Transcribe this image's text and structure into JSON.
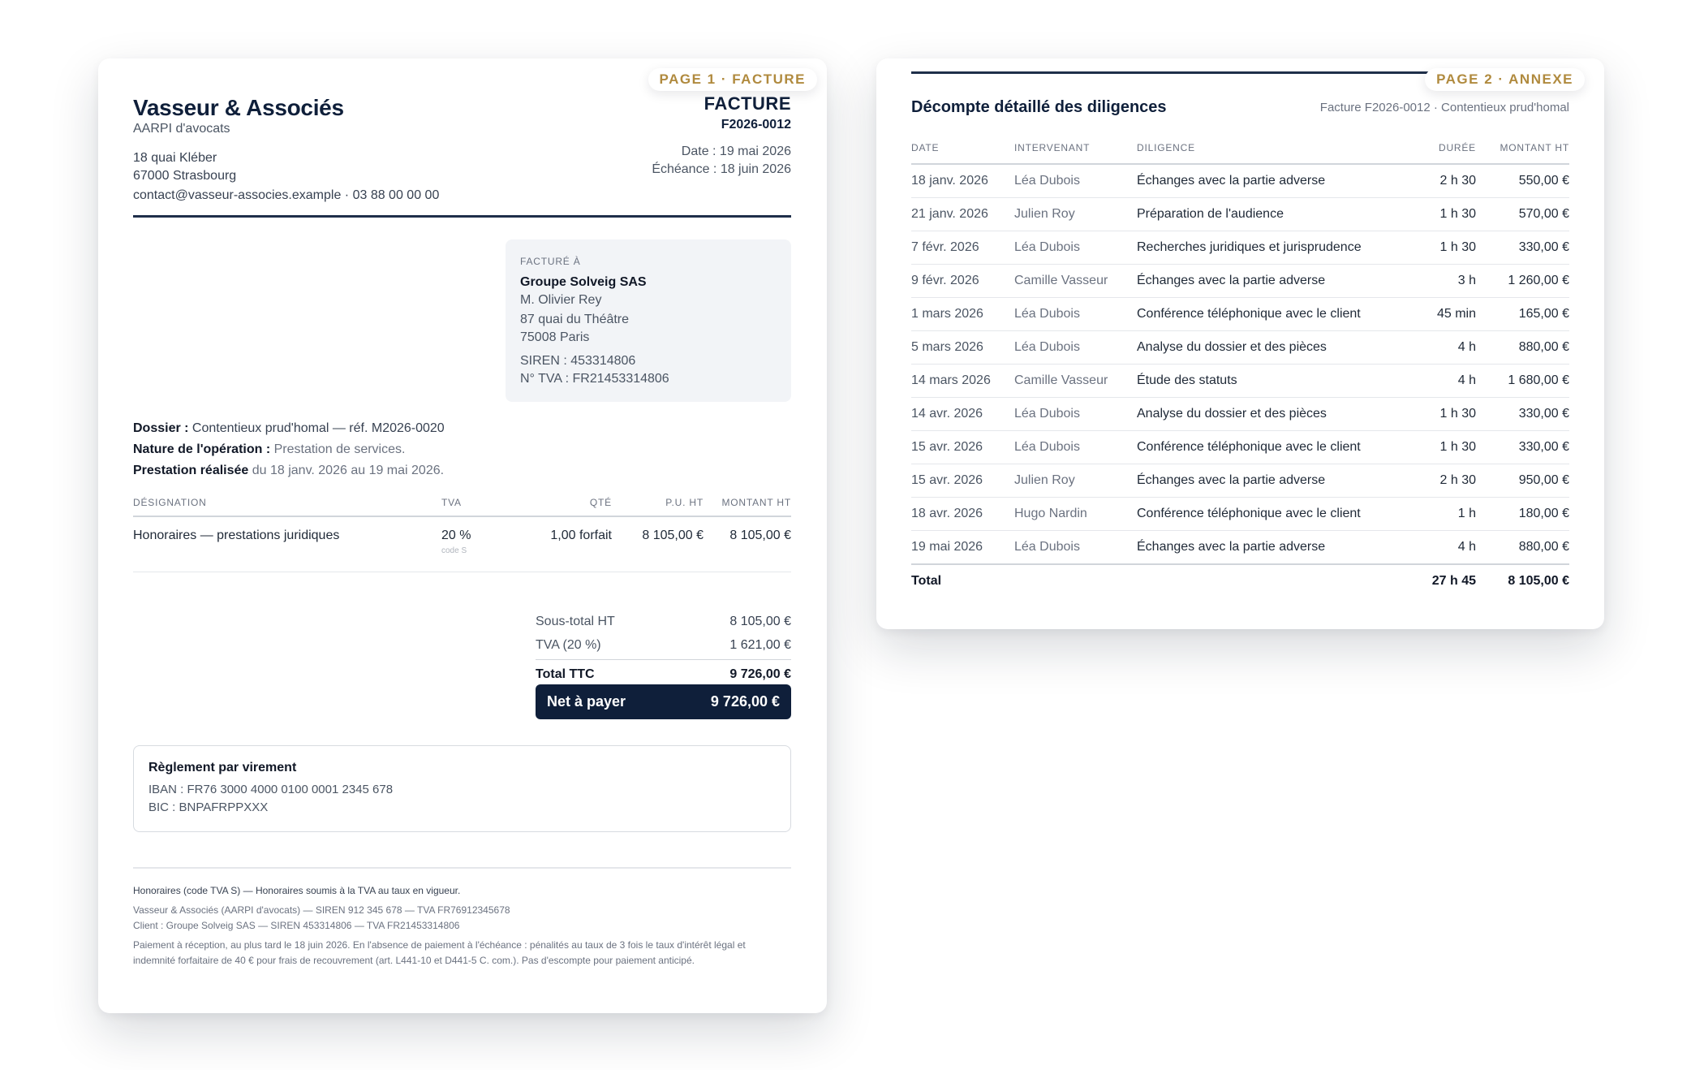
{
  "page1": {
    "tab": "PAGE 1 · FACTURE",
    "firm": {
      "name": "Vasseur & Associés",
      "subtitle": "AARPI d'avocats",
      "address1": "18 quai Kléber",
      "address2": "67000 Strasbourg",
      "contact": "contact@vasseur-associes.example · 03 88 00 00 00"
    },
    "doc": {
      "type": "FACTURE",
      "number": "F2026-0012",
      "date": "Date : 19 mai 2026",
      "due": "Échéance : 18 juin 2026"
    },
    "billto": {
      "caption": "FACTURÉ À",
      "name": "Groupe Solveig SAS",
      "contact": "M. Olivier Rey",
      "address1": "87 quai du Théâtre",
      "address2": "75008 Paris",
      "siren": "SIREN : 453314806",
      "tva": "N° TVA : FR21453314806"
    },
    "meta": {
      "dossier_label": "Dossier :",
      "dossier_value": " Contentieux prud'homal — réf. M2026-0020",
      "nature_label": "Nature de l'opération :",
      "nature_value": " Prestation de services.",
      "period_label": "Prestation réalisée",
      "period_value": " du 18 janv. 2026 au 19 mai 2026."
    },
    "table": {
      "headers": [
        "DÉSIGNATION",
        "TVA",
        "QTÉ",
        "P.U. HT",
        "MONTANT HT"
      ],
      "rows": [
        {
          "designation": "Honoraires — prestations juridiques",
          "tva": "20 %",
          "code": "code S",
          "qty": "1,00 forfait",
          "pu": "8 105,00 €",
          "amount": "8 105,00 €"
        }
      ]
    },
    "totals": {
      "subtotal_label": "Sous-total HT",
      "subtotal": "8 105,00 €",
      "tva_label": "TVA (20 %)",
      "tva": "1 621,00 €",
      "ttc_label": "Total TTC",
      "ttc": "9 726,00 €",
      "net_label": "Net à payer",
      "net": "9 726,00 €"
    },
    "payment": {
      "title": "Règlement par virement",
      "iban": "IBAN : FR76 3000 4000 0100 0001 2345 678",
      "bic": "BIC : BNPAFRPPXXX"
    },
    "footer": {
      "line1": "Honoraires (code TVA S) — Honoraires soumis à la TVA au taux en vigueur.",
      "line2": "Vasseur & Associés (AARPI d'avocats) — SIREN 912 345 678 — TVA FR76912345678",
      "line3": "Client : Groupe Solveig SAS — SIREN 453314806 — TVA FR21453314806",
      "line4": "Paiement à réception, au plus tard le 18 juin 2026. En l'absence de paiement à l'échéance : pénalités au taux de 3 fois le taux d'intérêt légal et",
      "line5": "indemnité forfaitaire de 40 € pour frais de recouvrement (art. L441-10 et D441-5 C. com.). Pas d'escompte pour paiement anticipé."
    }
  },
  "page2": {
    "tab": "PAGE 2 · ANNEXE",
    "title": "Décompte détaillé des diligences",
    "ref": "Facture F2026-0012 · Contentieux prud'homal",
    "headers": [
      "DATE",
      "INTERVENANT",
      "DILIGENCE",
      "DURÉE",
      "MONTANT HT"
    ],
    "rows": [
      {
        "date": "18 janv. 2026",
        "who": "Léa Dubois",
        "task": "Échanges avec la partie adverse",
        "duration": "2 h 30",
        "amount": "550,00 €"
      },
      {
        "date": "21 janv. 2026",
        "who": "Julien Roy",
        "task": "Préparation de l'audience",
        "duration": "1 h 30",
        "amount": "570,00 €"
      },
      {
        "date": "7 févr. 2026",
        "who": "Léa Dubois",
        "task": "Recherches juridiques et jurisprudence",
        "duration": "1 h 30",
        "amount": "330,00 €"
      },
      {
        "date": "9 févr. 2026",
        "who": "Camille Vasseur",
        "task": "Échanges avec la partie adverse",
        "duration": "3 h",
        "amount": "1 260,00 €"
      },
      {
        "date": "1 mars 2026",
        "who": "Léa Dubois",
        "task": "Conférence téléphonique avec le client",
        "duration": "45 min",
        "amount": "165,00 €"
      },
      {
        "date": "5 mars 2026",
        "who": "Léa Dubois",
        "task": "Analyse du dossier et des pièces",
        "duration": "4 h",
        "amount": "880,00 €"
      },
      {
        "date": "14 mars 2026",
        "who": "Camille Vasseur",
        "task": "Étude des statuts",
        "duration": "4 h",
        "amount": "1 680,00 €"
      },
      {
        "date": "14 avr. 2026",
        "who": "Léa Dubois",
        "task": "Analyse du dossier et des pièces",
        "duration": "1 h 30",
        "amount": "330,00 €"
      },
      {
        "date": "15 avr. 2026",
        "who": "Léa Dubois",
        "task": "Conférence téléphonique avec le client",
        "duration": "1 h 30",
        "amount": "330,00 €"
      },
      {
        "date": "15 avr. 2026",
        "who": "Julien Roy",
        "task": "Échanges avec la partie adverse",
        "duration": "2 h 30",
        "amount": "950,00 €"
      },
      {
        "date": "18 avr. 2026",
        "who": "Hugo Nardin",
        "task": "Conférence téléphonique avec le client",
        "duration": "1 h",
        "amount": "180,00 €"
      },
      {
        "date": "19 mai 2026",
        "who": "Léa Dubois",
        "task": "Échanges avec la partie adverse",
        "duration": "4 h",
        "amount": "880,00 €"
      }
    ],
    "total": {
      "label": "Total",
      "duration": "27 h 45",
      "amount": "8 105,00 €"
    }
  }
}
